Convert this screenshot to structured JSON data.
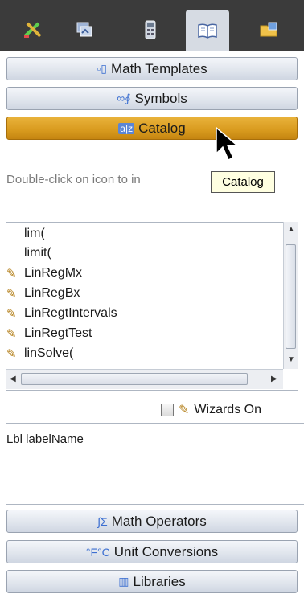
{
  "tabs": [
    {
      "icon": "scratchpad-icon"
    },
    {
      "icon": "document-tools-icon"
    },
    {
      "icon": "calculator-icon"
    },
    {
      "icon": "book-icon",
      "active": true
    },
    {
      "icon": "folder-icon"
    }
  ],
  "accordion": {
    "math_templates": "Math Templates",
    "symbols": "Symbols",
    "catalog": "Catalog",
    "math_operators": "Math Operators",
    "unit_conversions": "Unit Conversions",
    "libraries": "Libraries"
  },
  "catalog": {
    "hint": "Double-click on icon to in",
    "tooltip": "Catalog",
    "items": [
      {
        "label": "lim(",
        "wizard": false
      },
      {
        "label": "limit(",
        "wizard": false
      },
      {
        "label": "LinRegMx",
        "wizard": true
      },
      {
        "label": "LinRegBx",
        "wizard": true
      },
      {
        "label": "LinRegtIntervals",
        "wizard": true
      },
      {
        "label": "LinRegtTest",
        "wizard": true
      },
      {
        "label": "linSolve(",
        "wizard": true
      }
    ],
    "wizards_label": "Wizards On",
    "syntax": "Lbl labelName"
  },
  "colors": {
    "active_accent": "#d89a1e",
    "topbar": "#3b3b3b"
  }
}
